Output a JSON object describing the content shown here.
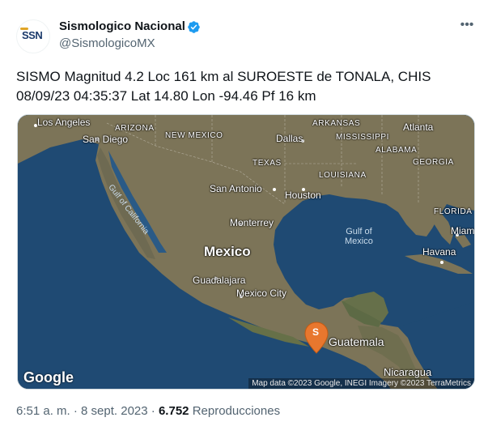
{
  "author": {
    "display_name": "Sismologico Nacional",
    "handle": "@SismologicoMX",
    "avatar_text": "SSN"
  },
  "tweet": {
    "text": "SISMO Magnitud 4.2 Loc  161 km al SUROESTE de TONALA, CHIS\n08/09/23 04:35:37 Lat 14.80 Lon -94.46 Pf 16 km"
  },
  "map": {
    "labels": {
      "los_angeles": "Los Angeles",
      "arizona": "ARIZONA",
      "new_mexico": "NEW MEXICO",
      "arkansas": "ARKANSAS",
      "atlanta": "Atlanta",
      "san_diego": "San Diego",
      "mississippi": "MISSISSIPPI",
      "dallas": "Dallas",
      "alabama": "ALABAMA",
      "texas": "TEXAS",
      "georgia": "GEORGIA",
      "louisiana": "LOUISIANA",
      "san_antonio": "San Antonio",
      "houston": "Houston",
      "gulf_of_california": "Gulf of California",
      "florida": "FLORIDA",
      "monterrey": "Monterrey",
      "gulf_of_mexico": "Gulf of\nMexico",
      "miami": "Miami",
      "mexico": "Mexico",
      "havana": "Havana",
      "guadalajara": "Guadalajara",
      "mexico_city": "Mexico City",
      "guatemala": "Guatemala",
      "nicaragua": "Nicaragua"
    },
    "marker_letter": "S",
    "google_logo": "Google",
    "attribution": "Map data ©2023 Google, INEGI Imagery ©2023 TerraMetrics"
  },
  "meta": {
    "time": "6:51 a. m.",
    "separator": "·",
    "date": "8 sept. 2023",
    "views_count": "6.752",
    "views_label": "Reproducciones"
  },
  "colors": {
    "verified": "#1d9bf0",
    "marker": "#e8772e",
    "ocean": "#1f4a73",
    "land": "#7c7458"
  }
}
